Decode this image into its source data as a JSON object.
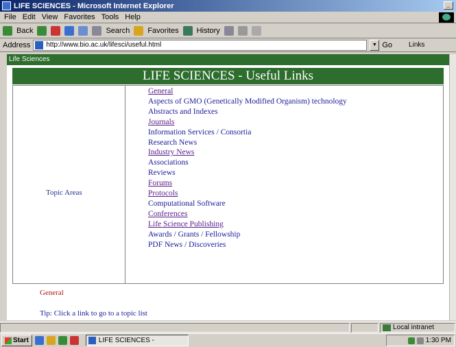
{
  "window": {
    "title": "LIFE SCIENCES - Microsoft Internet Explorer"
  },
  "menu": {
    "items": [
      "File",
      "Edit",
      "View",
      "Favorites",
      "Tools",
      "Help"
    ]
  },
  "toolbar": {
    "back": "Back",
    "search": "Search",
    "favorites": "Favorites",
    "history": "History"
  },
  "address": {
    "label": "Address",
    "value": "http://www.bio.ac.uk/lifesci/useful.html",
    "go": "Go",
    "links": "Links"
  },
  "page": {
    "site_name": "Life Sciences",
    "heading": "LIFE SCIENCES - Useful Links",
    "topic_label": "Topic Areas",
    "links": [
      {
        "label": "General",
        "underline": true
      },
      {
        "label": "Aspects of GMO (Genetically Modified Organism) technology",
        "underline": false
      },
      {
        "label": "Abstracts and Indexes",
        "underline": false
      },
      {
        "label": "Journals",
        "underline": true
      },
      {
        "label": "Information Services / Consortia",
        "underline": false
      },
      {
        "label": "Research News",
        "underline": false
      },
      {
        "label": "Industry News",
        "underline": true
      },
      {
        "label": "Associations",
        "underline": false
      },
      {
        "label": "Reviews",
        "underline": false
      },
      {
        "label": "Forums",
        "underline": true
      },
      {
        "label": "Protocols",
        "underline": true
      },
      {
        "label": "Computational Software",
        "underline": false
      },
      {
        "label": "Conferences",
        "underline": true
      },
      {
        "label": "Life Science Publishing",
        "underline": true
      },
      {
        "label": "Awards / Grants / Fellowship",
        "underline": false
      },
      {
        "label": "PDF News / Discoveries",
        "underline": false
      }
    ],
    "general_heading": "General",
    "tip_link": "Tip: Click a link to go to a topic list"
  },
  "status": {
    "text": "",
    "zone": "Local intranet"
  },
  "taskbar": {
    "start": "Start",
    "task": "LIFE SCIENCES - Microsoft...",
    "clock": "1:30 PM"
  },
  "colors": {
    "page_green": "#2d6d2d",
    "link_blue": "#1a1a9a",
    "general_red": "#b01818"
  }
}
